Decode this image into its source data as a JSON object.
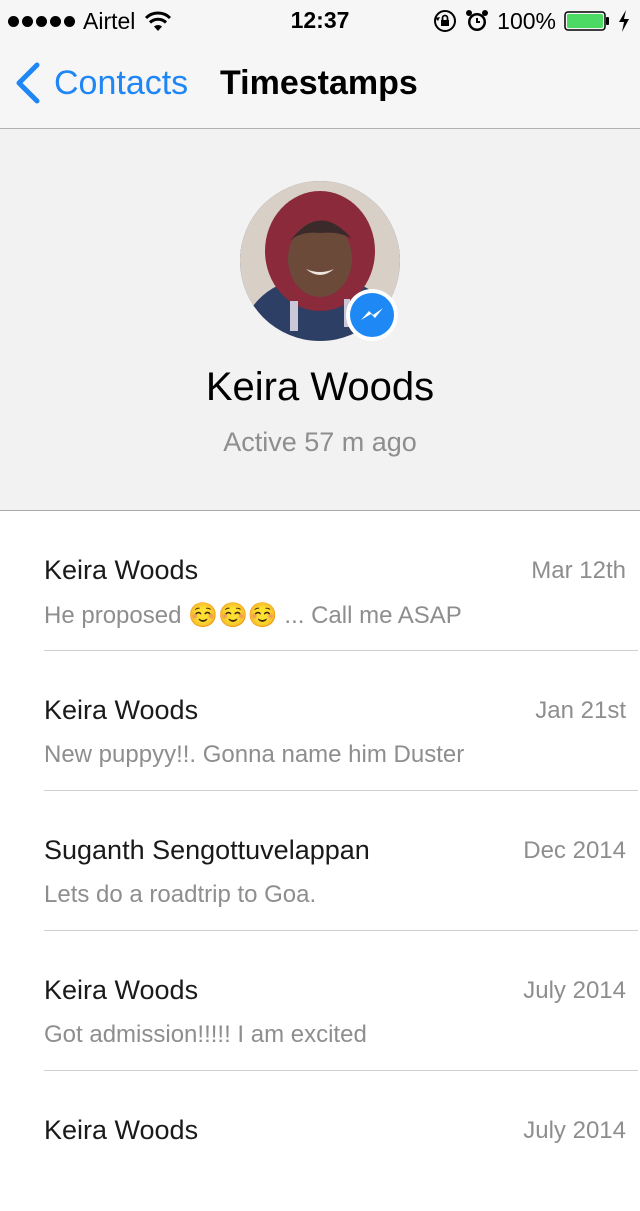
{
  "status_bar": {
    "carrier": "Airtel",
    "time": "12:37",
    "battery_percent": "100%",
    "signal_dots": 5,
    "battery_level": 1.0,
    "icons": [
      "signal-dots-icon",
      "wifi-icon",
      "rotation-lock-icon",
      "alarm-icon",
      "battery-icon",
      "charging-icon"
    ]
  },
  "nav": {
    "back_label": "Contacts",
    "title": "Timestamps"
  },
  "profile": {
    "name": "Keira Woods",
    "status": "Active 57 m ago",
    "badge_icon": "messenger-icon"
  },
  "conversations": [
    {
      "name": "Keira Woods",
      "date": "Mar 12th",
      "message": "He proposed ☺️☺️☺️ ... Call me ASAP"
    },
    {
      "name": "Keira Woods",
      "date": "Jan 21st",
      "message": "New puppyy!!. Gonna name him Duster"
    },
    {
      "name": "Suganth Sengottuvelappan",
      "date": "Dec 2014",
      "message": "Lets do a roadtrip to Goa."
    },
    {
      "name": "Keira Woods",
      "date": "July 2014",
      "message": "Got admission!!!!! I am excited"
    },
    {
      "name": "Keira Woods",
      "date": "July 2014",
      "message": ""
    }
  ],
  "colors": {
    "accent": "#1f86f5",
    "messenger": "#1e88f5",
    "secondary_text": "#8e8e8e",
    "header_bg": "#f2f2f2",
    "battery": "#4cd964"
  }
}
